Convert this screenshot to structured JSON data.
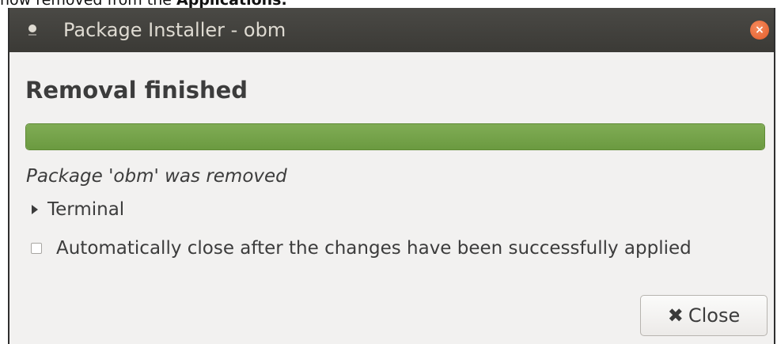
{
  "caption": {
    "prefix": "now removed from the ",
    "bold": "Applications."
  },
  "window": {
    "title": "Package Installer - obm",
    "close_icon": "close-icon"
  },
  "dialog": {
    "heading": "Removal finished",
    "progress_fraction": 1.0,
    "status": "Package 'obm' was removed",
    "terminal_label": "Terminal",
    "auto_close_label": "Automatically close after the changes have been successfully applied",
    "auto_close_checked": false,
    "close_button_label": "Close"
  },
  "colors": {
    "titlebar": "#3b3a36",
    "progress_fill": "#6b9a40",
    "window_close": "#e35d2b"
  }
}
